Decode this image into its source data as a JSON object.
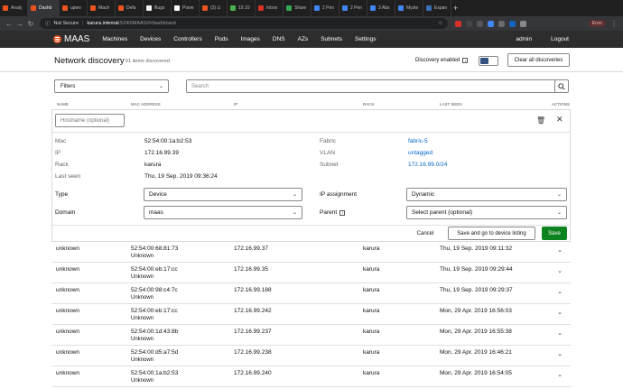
{
  "browser": {
    "tabs": [
      {
        "label": "Analy",
        "color": "#e95420"
      },
      {
        "label": "Dashb",
        "color": "#e95420",
        "active": true
      },
      {
        "label": "upwo",
        "color": "#e95420"
      },
      {
        "label": "Mach",
        "color": "#e95420"
      },
      {
        "label": "Defa",
        "color": "#e95420"
      },
      {
        "label": "Bugs",
        "color": "#f3f3f3"
      },
      {
        "label": "Powe",
        "color": "#ffffff"
      },
      {
        "label": "(3) Li",
        "color": "#e95420"
      },
      {
        "label": "19.10",
        "color": "#4caf50"
      },
      {
        "label": "Inbox",
        "color": "#d93025"
      },
      {
        "label": "Share",
        "color": "#34a853"
      },
      {
        "label": "2 Pen",
        "color": "#4285f4"
      },
      {
        "label": "2 Pen",
        "color": "#4285f4"
      },
      {
        "label": "3 Abs",
        "color": "#4285f4"
      },
      {
        "label": "Myste",
        "color": "#4285f4"
      },
      {
        "label": "Expan",
        "color": "#3c6eb4"
      }
    ],
    "new_tab": "+",
    "not_secure": "Not Secure",
    "url_host": "karura.internal",
    "url_path": ":5240/MAAS/#/dashboard",
    "error_label": "Error"
  },
  "header": {
    "brand": "MAAS",
    "nav": [
      "Machines",
      "Devices",
      "Controllers",
      "Pods",
      "Images",
      "DNS",
      "AZs",
      "Subnets",
      "Settings"
    ],
    "user": "admin",
    "logout": "Logout"
  },
  "page": {
    "title": "Network discovery",
    "count": "61 items discovered",
    "discovery_label": "Discovery enabled",
    "discovery_info": "i",
    "discovery_enabled": true,
    "clear_button": "Clear all discoveries"
  },
  "filters": {
    "filter_label": "Filters",
    "search_placeholder": "Search"
  },
  "table_headers": [
    "Name",
    "MAC address",
    "IP",
    "Rack",
    "Last seen",
    "Actions"
  ],
  "form": {
    "hostname_placeholder": "Hostname (optional)",
    "mac_label": "Mac",
    "mac_value": "52:54:00:1a:b2:53",
    "ip_label": "IP",
    "ip_value": "172.16.99.39",
    "rack_label": "Rack",
    "rack_value": "karura",
    "lastseen_label": "Last seen",
    "lastseen_value": "Thu, 19 Sep. 2019 09:36:24",
    "fabric_label": "Fabric",
    "fabric_value": "fabric-5",
    "vlan_label": "VLAN",
    "vlan_value": "untagged",
    "subnet_label": "Subnet",
    "subnet_value": "172.16.99.0/24",
    "type_label": "Type",
    "type_value": "Device",
    "domain_label": "Domain",
    "domain_value": "maas",
    "ipassign_label": "IP assignment",
    "ipassign_value": "Dynamic",
    "parent_label": "Parent",
    "parent_info": "i",
    "parent_value": "Select parent (optional)",
    "cancel": "Cancel",
    "save_go": "Save and go to device listing",
    "save": "Save"
  },
  "rows": [
    {
      "name": "unknown",
      "mac": "52:54:00:68:81:73",
      "vendor": "Unknown",
      "ip": "172.16.99.37",
      "rack": "karura",
      "seen": "Thu, 19 Sep. 2019 09:11:32"
    },
    {
      "name": "unknown",
      "mac": "52:54:00:eb:17:cc",
      "vendor": "Unknown",
      "ip": "172.16.99.35",
      "rack": "karura",
      "seen": "Thu, 19 Sep. 2019 09:29:44"
    },
    {
      "name": "unknown",
      "mac": "52:54:00:98:c4:7c",
      "vendor": "Unknown",
      "ip": "172.16.99.188",
      "rack": "karura",
      "seen": "Thu, 19 Sep. 2019 09:29:37"
    },
    {
      "name": "unknown",
      "mac": "52:54:00:eb:17:cc",
      "vendor": "Unknown",
      "ip": "172.16.99.242",
      "rack": "karura",
      "seen": "Mon, 29 Apr. 2019 16:56:03"
    },
    {
      "name": "unknown",
      "mac": "52:54:00:1d:43:8b",
      "vendor": "Unknown",
      "ip": "172.16.99.237",
      "rack": "karura",
      "seen": "Mon, 29 Apr. 2019 16:55:38"
    },
    {
      "name": "unknown",
      "mac": "52:54:00:d5:a7:5d",
      "vendor": "Unknown",
      "ip": "172.16.99.238",
      "rack": "karura",
      "seen": "Mon, 29 Apr. 2019 16:46:21"
    },
    {
      "name": "unknown",
      "mac": "52:54:00:1a:b2:53",
      "vendor": "Unknown",
      "ip": "172.16.99.240",
      "rack": "karura",
      "seen": "Mon, 29 Apr. 2019 16:54:05"
    }
  ]
}
